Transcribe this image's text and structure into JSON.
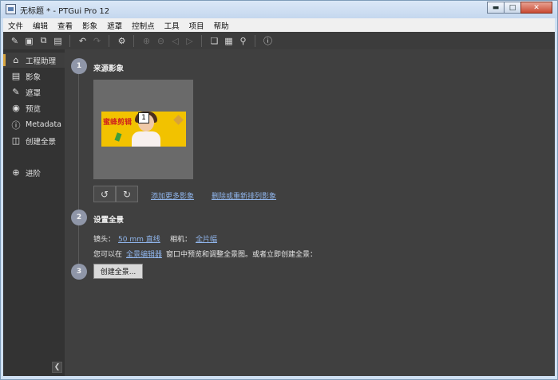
{
  "window": {
    "title": "无标题 * - PTGui Pro 12",
    "min_icon": "minimize-icon",
    "max_icon": "maximize-icon",
    "close_icon": "close-icon"
  },
  "menubar": [
    "文件",
    "编辑",
    "查看",
    "影象",
    "遮罩",
    "控制点",
    "工具",
    "项目",
    "帮助"
  ],
  "toolbar": {
    "icons": [
      "new-project-icon",
      "open-project-icon",
      "copy-icon",
      "save-icon",
      "undo-icon",
      "redo-icon",
      "settings-icon",
      "zoom-in-icon",
      "zoom-out-icon",
      "first-image-icon",
      "last-image-icon",
      "panorama-editor-icon",
      "table-icon",
      "bulb-icon",
      "help-icon"
    ]
  },
  "sidebar": {
    "items": [
      {
        "label": "工程助理",
        "icon": "home-icon",
        "active": true
      },
      {
        "label": "影象",
        "icon": "image-icon",
        "active": false
      },
      {
        "label": "遮罩",
        "icon": "mask-icon",
        "active": false
      },
      {
        "label": "预览",
        "icon": "eye-icon",
        "active": false
      },
      {
        "label": "Metadata",
        "icon": "info-icon",
        "active": false
      },
      {
        "label": "创建全景",
        "icon": "panorama-icon",
        "active": false
      }
    ],
    "advanced": {
      "label": "进阶",
      "icon": "chevron-circle-down-icon"
    },
    "collapse_icon": "chevron-left-icon"
  },
  "steps": [
    {
      "number": "1",
      "title": "来源影象"
    },
    {
      "number": "2",
      "title": "设置全景"
    },
    {
      "number": "3",
      "title": ""
    }
  ],
  "source": {
    "thumbnail_caption": "蜜蜂剪辑",
    "image_number": "1",
    "rotate_left_icon": "rotate-left-icon",
    "rotate_right_icon": "rotate-right-icon",
    "add_more_link": "添加更多影象",
    "remove_link": "删除或重新排列影象"
  },
  "setup": {
    "lens_label": "镜头：",
    "lens_value": "50 mm 直线",
    "camera_label": "相机：",
    "camera_value": "全片幅",
    "editor_prefix": "您可以在",
    "editor_link": "全景编辑器",
    "editor_suffix": "窗口中预览和调整全景图。或者立即创建全景："
  },
  "create": {
    "button_label": "创建全景..."
  }
}
